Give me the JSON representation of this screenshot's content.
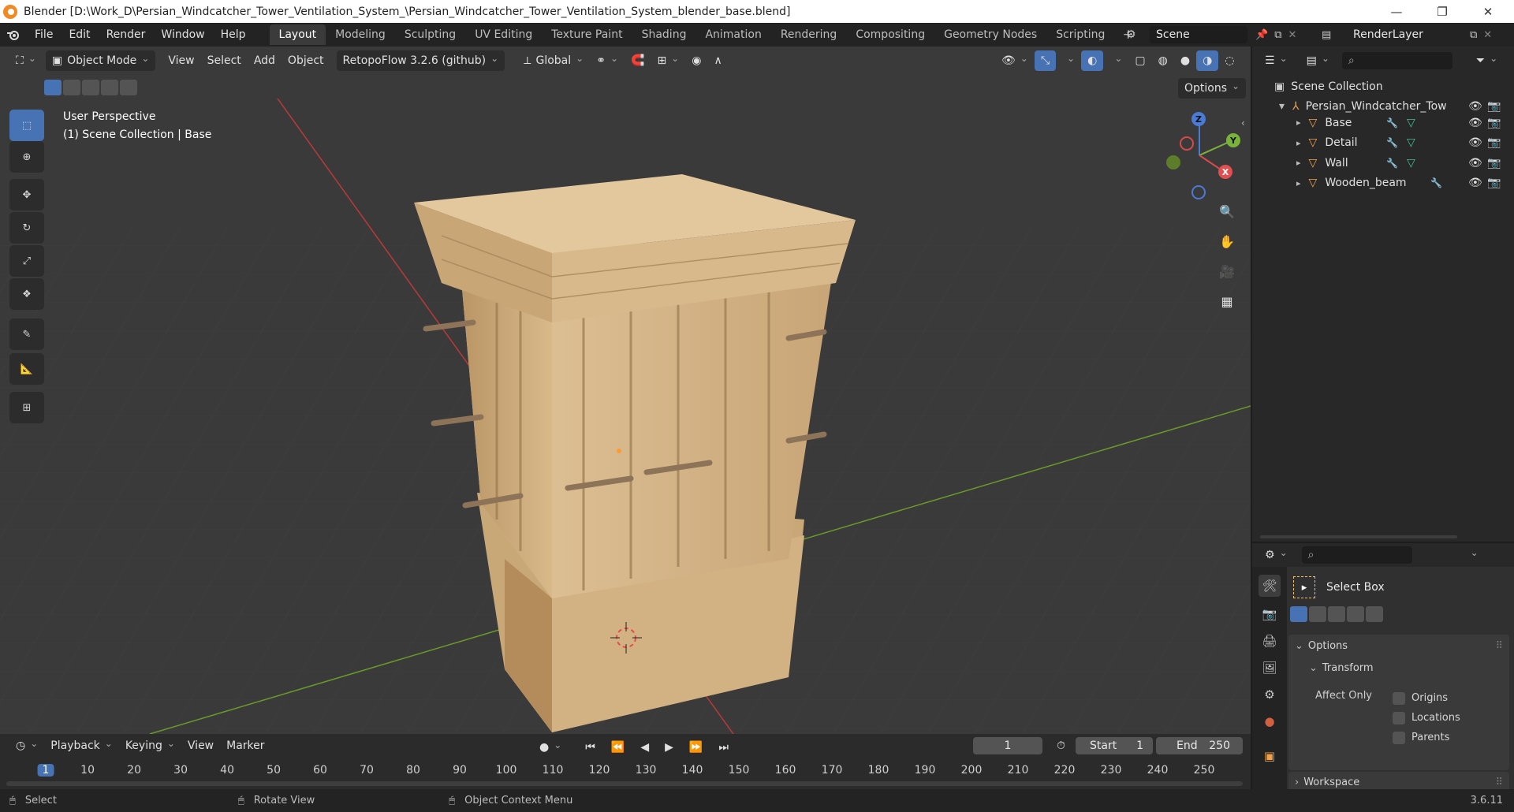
{
  "window": {
    "title": "Blender [D:\\Work_D\\Persian_Windcatcher_Tower_Ventilation_System_\\Persian_Windcatcher_Tower_Ventilation_System_blender_base.blend]",
    "minimize": "—",
    "maximize": "❐",
    "close": "✕"
  },
  "menus": [
    "File",
    "Edit",
    "Render",
    "Window",
    "Help"
  ],
  "workspaces": [
    "Layout",
    "Modeling",
    "Sculpting",
    "UV Editing",
    "Texture Paint",
    "Shading",
    "Animation",
    "Rendering",
    "Compositing",
    "Geometry Nodes",
    "Scripting"
  ],
  "active_workspace": "Layout",
  "add_workspace": "+",
  "scene": {
    "name": "Scene",
    "layer": "RenderLayer"
  },
  "viewport": {
    "mode": "Object Mode",
    "menus": [
      "View",
      "Select",
      "Add",
      "Object"
    ],
    "addon": "RetopoFlow 3.2.6 (github)",
    "orientation": "Global",
    "options": "Options",
    "overlay_title": "User Perspective",
    "overlay_subtitle": "(1) Scene Collection | Base",
    "gizmo": {
      "z": "Z",
      "y": "Y",
      "x": "X"
    }
  },
  "outliner": {
    "root": "Scene Collection",
    "collection": "Persian_Windcatcher_Tow",
    "objects": [
      "Base",
      "Detail",
      "Wall",
      "Wooden_beam"
    ]
  },
  "properties": {
    "tool_name": "Select Box",
    "options": "Options",
    "transform": "Transform",
    "affect_only": "Affect Only",
    "checkboxes": [
      "Origins",
      "Locations",
      "Parents"
    ],
    "workspace": "Workspace"
  },
  "timeline": {
    "menus": [
      "Playback",
      "Keying",
      "View",
      "Marker"
    ],
    "current_frame": "1",
    "start_label": "Start",
    "start": "1",
    "end_label": "End",
    "end": "250",
    "ticks": [
      "1",
      "10",
      "20",
      "30",
      "40",
      "50",
      "60",
      "70",
      "80",
      "90",
      "100",
      "110",
      "120",
      "130",
      "140",
      "150",
      "160",
      "170",
      "180",
      "190",
      "200",
      "210",
      "220",
      "230",
      "240",
      "250"
    ]
  },
  "status": {
    "select": "Select",
    "rotate": "Rotate View",
    "context": "Object Context Menu",
    "version": "3.6.11"
  },
  "colors": {
    "accent": "#4772b3",
    "object_orange": "#f0a24a",
    "modifier_blue": "#6ba0e8",
    "mesh_green": "#3fbf8f"
  }
}
